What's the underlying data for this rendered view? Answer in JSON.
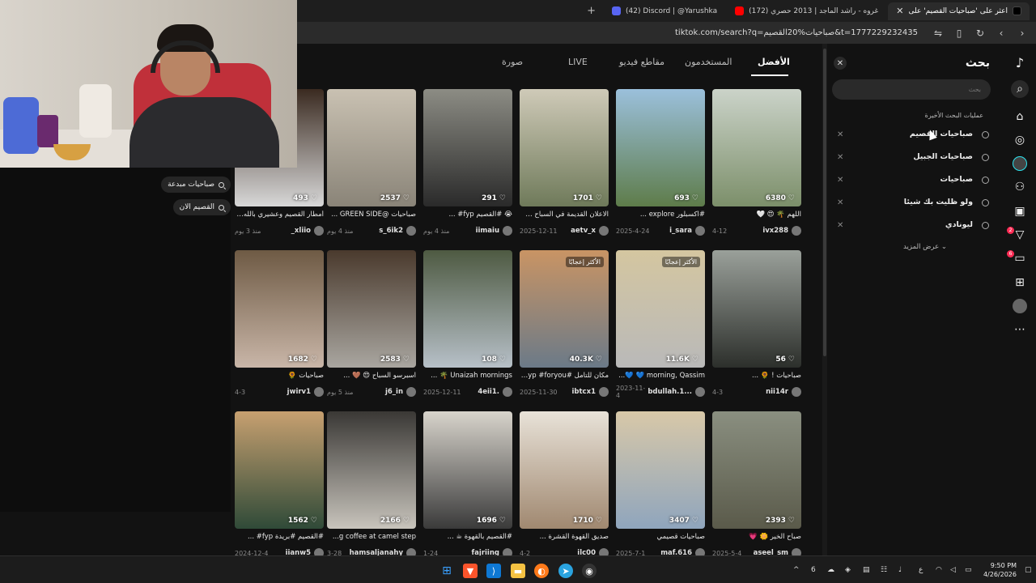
{
  "browser": {
    "tabs": [
      {
        "label": "(42) Discord | @Yarushka",
        "color": "#5865f2",
        "active": false
      },
      {
        "label": "(172) غروه - راشد الماجد | 2013 حصري",
        "color": "#ff0000",
        "active": false
      },
      {
        "label": "اعثر على 'صباحيات القصيم' على",
        "color": "#111111",
        "active": true
      }
    ],
    "new_tab_label": "+",
    "url": "tiktok.com/search?q=صباحيات%20القصيم&t=1777229232435"
  },
  "tiktok": {
    "tabs": [
      "الأفضل",
      "المستخدمون",
      "مقاطع فيديو",
      "LIVE",
      "صورة"
    ],
    "active_tab": "الأفضل",
    "related_searches": [
      "صباحيات مبدعة",
      "القصيم الان"
    ],
    "grid": [
      [
        {
          "count": "6380",
          "caption": "اللهم 🌴 😍 🤍",
          "author": "ivx288",
          "date": "4-12",
          "img": "palms-car",
          "badge": ""
        },
        {
          "count": "693",
          "caption": "#اكسبلور explore ...",
          "author": "i_sara",
          "date": "2025-4-24",
          "img": "garden",
          "badge": ""
        },
        {
          "count": "1701",
          "caption": "الاعلان القديمة في السباح 💗 ...",
          "author": "aetv_x",
          "date": "2025-12-11",
          "img": "palm-road",
          "badge": ""
        },
        {
          "count": "291",
          "caption": "😭 #القصيم fyp# ...",
          "author": "iimaiu",
          "date": "منذ 4 يوم",
          "img": "window",
          "badge": ""
        },
        {
          "count": "2537",
          "caption": "صباحيات @GREEN SIDE ...",
          "author": "s_6ik2",
          "date": "منذ 4 يوم",
          "img": "legs",
          "badge": ""
        },
        {
          "count": "493",
          "caption": "أمطار القصيم وعشيري بالله الجد...",
          "author": "_xliio",
          "date": "منذ 3 يوم",
          "img": "coffee-rain",
          "badge": ""
        }
      ],
      [
        {
          "count": "56",
          "caption": "صباحيات ! 🌻 ...",
          "author": "nii14r",
          "date": "4-3",
          "img": "sign",
          "badge": ""
        },
        {
          "count": "11.6K",
          "caption": "morning, Qassim 💙 💙...",
          "author": "bdullah.1...",
          "date": "2023-11-4",
          "img": "tower",
          "badge": "الأكثر إعجابًا"
        },
        {
          "count": "40.3K",
          "caption": "مكان للتأمل #fyp #foryou ...",
          "author": "ibtcx1",
          "date": "2025-11-30",
          "img": "desert",
          "badge": "الأكثر إعجابًا"
        },
        {
          "count": "108",
          "caption": "Unaizah mornings 🌴 ...",
          "author": "4eii1.",
          "date": "2025-12-11",
          "img": "palms-sky",
          "badge": ""
        },
        {
          "count": "2583",
          "caption": "اسبرسو السباح 😍 🤎 ...",
          "author": "j6_in",
          "date": "منذ 5 يوم",
          "img": "armchair",
          "badge": ""
        },
        {
          "count": "1682",
          "caption": "صباحيات 🌻",
          "author": "jwirv1",
          "date": "4-3",
          "img": "flowers",
          "badge": ""
        }
      ],
      [
        {
          "count": "2393",
          "caption": "صباح الخير 🌼 💗",
          "author": "aseel_sm",
          "date": "2025-5-4",
          "img": "wet-street",
          "badge": ""
        },
        {
          "count": "3407",
          "caption": "صباحيات قصيمي",
          "author": "maf.616",
          "date": "2025-7-1",
          "img": "house-palm",
          "badge": ""
        },
        {
          "count": "1710",
          "caption": "صديق القهوة القشرة ...",
          "author": "ilc00",
          "date": "4-2",
          "img": "cup",
          "badge": ""
        },
        {
          "count": "1696",
          "caption": "#القصيم بالقهوة ☕ ...",
          "author": "fajriing",
          "date": "1-24",
          "img": "girl-car",
          "badge": ""
        },
        {
          "count": "2166",
          "caption": "g coffee at camel step...",
          "author": "hamsaljanahy",
          "date": "3-28",
          "img": "mirror",
          "badge": ""
        },
        {
          "count": "1562",
          "caption": "#القصيم #بريدة fyp# ...",
          "author": "iianw5",
          "date": "2024-12-4",
          "img": "cafe-green",
          "badge": ""
        }
      ]
    ],
    "search_panel": {
      "title": "بحث",
      "close_icon": "close-icon",
      "search_placeholder": "بحث",
      "recent_title": "عمليات البحث الأخيرة",
      "recent": [
        "صباحيات القصيم",
        "صباحيات الجبيل",
        "صباحيات",
        "ولو ظليت بك شيئا",
        "ليونادي"
      ],
      "show_more": "عرض المزيد"
    },
    "rail_icons": [
      "tiktok-logo-icon",
      "search-icon",
      "home-icon",
      "explore-icon",
      "following-icon",
      "friends-icon",
      "live-icon",
      "activity-icon",
      "messages-icon",
      "upload-icon",
      "profile-icon",
      "more-icon"
    ],
    "rail_badges": {
      "activity": "2",
      "messages": "6"
    }
  },
  "taskbar": {
    "time": "9:50 PM",
    "date": "4/26/2026",
    "lang": "ع",
    "apps": [
      "windows-start-icon",
      "brave-icon",
      "vscode-icon",
      "file-explorer-icon",
      "app-orange-icon",
      "telegram-icon",
      "github-icon"
    ]
  }
}
